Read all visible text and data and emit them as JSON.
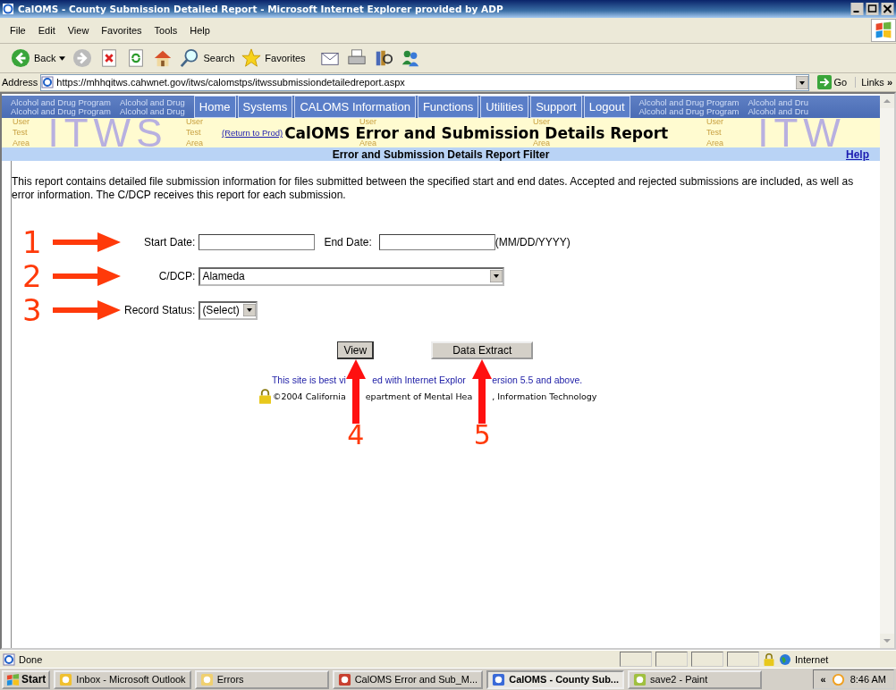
{
  "window": {
    "title": "CalOMS - County Submission Detailed Report - Microsoft Internet Explorer provided by ADP"
  },
  "menu": [
    "File",
    "Edit",
    "View",
    "Favorites",
    "Tools",
    "Help"
  ],
  "toolbar": [
    {
      "kind": "back",
      "label": "Back"
    },
    {
      "kind": "forward"
    },
    {
      "kind": "stop"
    },
    {
      "kind": "refresh"
    },
    {
      "kind": "home"
    },
    {
      "kind": "search",
      "label": "Search"
    },
    {
      "kind": "favorites",
      "label": "Favorites"
    },
    {
      "kind": "mail"
    },
    {
      "kind": "print"
    },
    {
      "kind": "research"
    },
    {
      "kind": "messenger"
    }
  ],
  "address": {
    "label": "Address",
    "url": "https://mhhqitws.cahwnet.gov/itws/calomstps/itwssubmissiondetailedreport.aspx",
    "go": "Go",
    "links": "Links",
    "more": "»"
  },
  "banner": {
    "left_texts": [
      {
        "lines": [
          "Alcohol and Drug Program",
          "Alcohol and Drug Program"
        ]
      },
      {
        "lines": [
          "Alcohol and Drug",
          "Alcohol and Drug"
        ]
      }
    ],
    "nav": [
      {
        "label": "Home"
      },
      {
        "label": "Systems"
      },
      {
        "label": "CALOMS Information"
      },
      {
        "label": "Functions"
      },
      {
        "label": "Utilities"
      },
      {
        "label": "Support"
      },
      {
        "label": "Logout"
      }
    ],
    "right_texts": [
      {
        "lines": [
          "Alcohol and Drug Program",
          "Alcohol and Drug Program"
        ]
      },
      {
        "lines": [
          "Alcohol and Dru",
          "Alcohol and Dru"
        ]
      }
    ],
    "area_marks": [
      {
        "lines": [
          "User",
          "Test",
          "Area"
        ]
      },
      {
        "lines": [
          "User",
          "Test",
          "Area"
        ]
      },
      {
        "lines": [
          "User",
          "Area"
        ]
      },
      {
        "lines": [
          "User",
          "Area"
        ]
      },
      {
        "lines": [
          "User",
          "Test",
          "Area"
        ]
      }
    ],
    "watermark": [
      "ITWS",
      "ITW"
    ],
    "return_link": "(Return to Prod)",
    "title": "CalOMS Error and Submission Details Report"
  },
  "filter_bar": {
    "title": "Error and Submission Details Report Filter",
    "help": "Help"
  },
  "description": "This report contains detailed file submission information for files submitted between the specified start and end dates.  Accepted and rejected submissions are included, as well as error information.  The C/DCP receives this report for each submission.",
  "form": {
    "start_label": "Start Date:",
    "end_label": "End Date:",
    "date_hint": "(MM/DD/YYYY)",
    "cdcp_label": "C/DCP:",
    "cdcp_value": "Alameda",
    "status_label": "Record Status:",
    "status_value": "(Select)"
  },
  "buttons": [
    {
      "label": "View"
    },
    {
      "label": "Data Extract"
    }
  ],
  "footer": {
    "browser_note": [
      "This site is best vi",
      "ed with Internet Explor",
      "ersion 5.5 and above."
    ],
    "copyright": [
      "©2004 California ",
      "epartment of Mental Hea",
      ", Information Technology"
    ]
  },
  "annotations": [
    {
      "label": "1"
    },
    {
      "label": "2"
    },
    {
      "label": "3"
    },
    {
      "label": "4"
    },
    {
      "label": "5"
    }
  ],
  "status_bar": {
    "text": "Done",
    "zone": "Internet"
  },
  "taskbar": {
    "start": "Start",
    "items": [
      {
        "label": "Inbox - Microsoft Outlook",
        "selected": false
      },
      {
        "label": "Errors",
        "selected": false
      },
      {
        "label": "CalOMS Error and Sub_M...",
        "selected": false
      },
      {
        "label": "CalOMS - County Sub...",
        "selected": true
      },
      {
        "label": "save2 - Paint",
        "selected": false
      }
    ],
    "tray_toggle": "«",
    "time": "8:46 AM"
  }
}
